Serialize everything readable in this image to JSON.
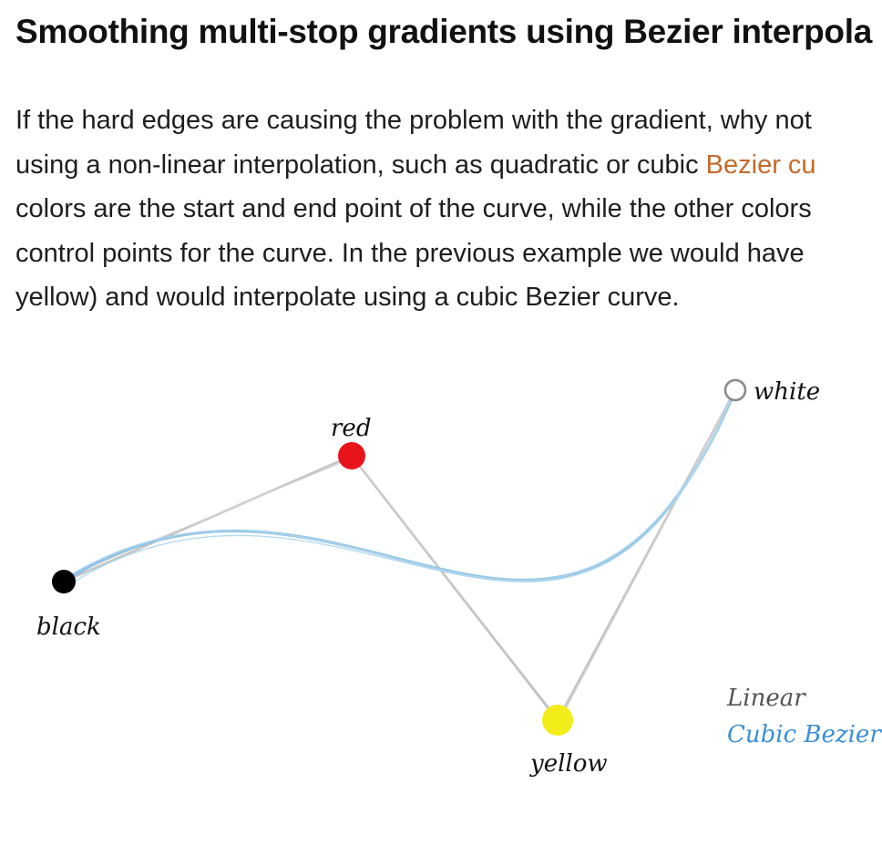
{
  "article": {
    "heading": "Smoothing multi-stop gradients using Bezier interpola",
    "paragraph": {
      "line1": "If the hard edges are causing the problem with the gradient, why not",
      "line2_pre": "using a non-linear interpolation, such as quadratic or cubic ",
      "line2_link": "Bezier cu",
      "line3": "colors are the start and end point of the curve, while the other colors",
      "line4": "control points for the curve. In the previous example we would have",
      "line5": "yellow) and would interpolate using a cubic Bezier curve."
    }
  },
  "figure": {
    "points": {
      "black": {
        "label": "black",
        "color": "#000000"
      },
      "red": {
        "label": "red",
        "color": "#e8141c"
      },
      "white": {
        "label": "white",
        "color": "#ffffff"
      },
      "yellow": {
        "label": "yellow",
        "color": "#f2ec18"
      }
    },
    "legend": {
      "linear": "Linear",
      "bezier": "Cubic Bezier"
    },
    "colors": {
      "linear_line": "#b5b5b5",
      "bezier_line": "#8fc3e3",
      "legend_linear": "#555555",
      "legend_bezier": "#3b8fd6"
    }
  }
}
